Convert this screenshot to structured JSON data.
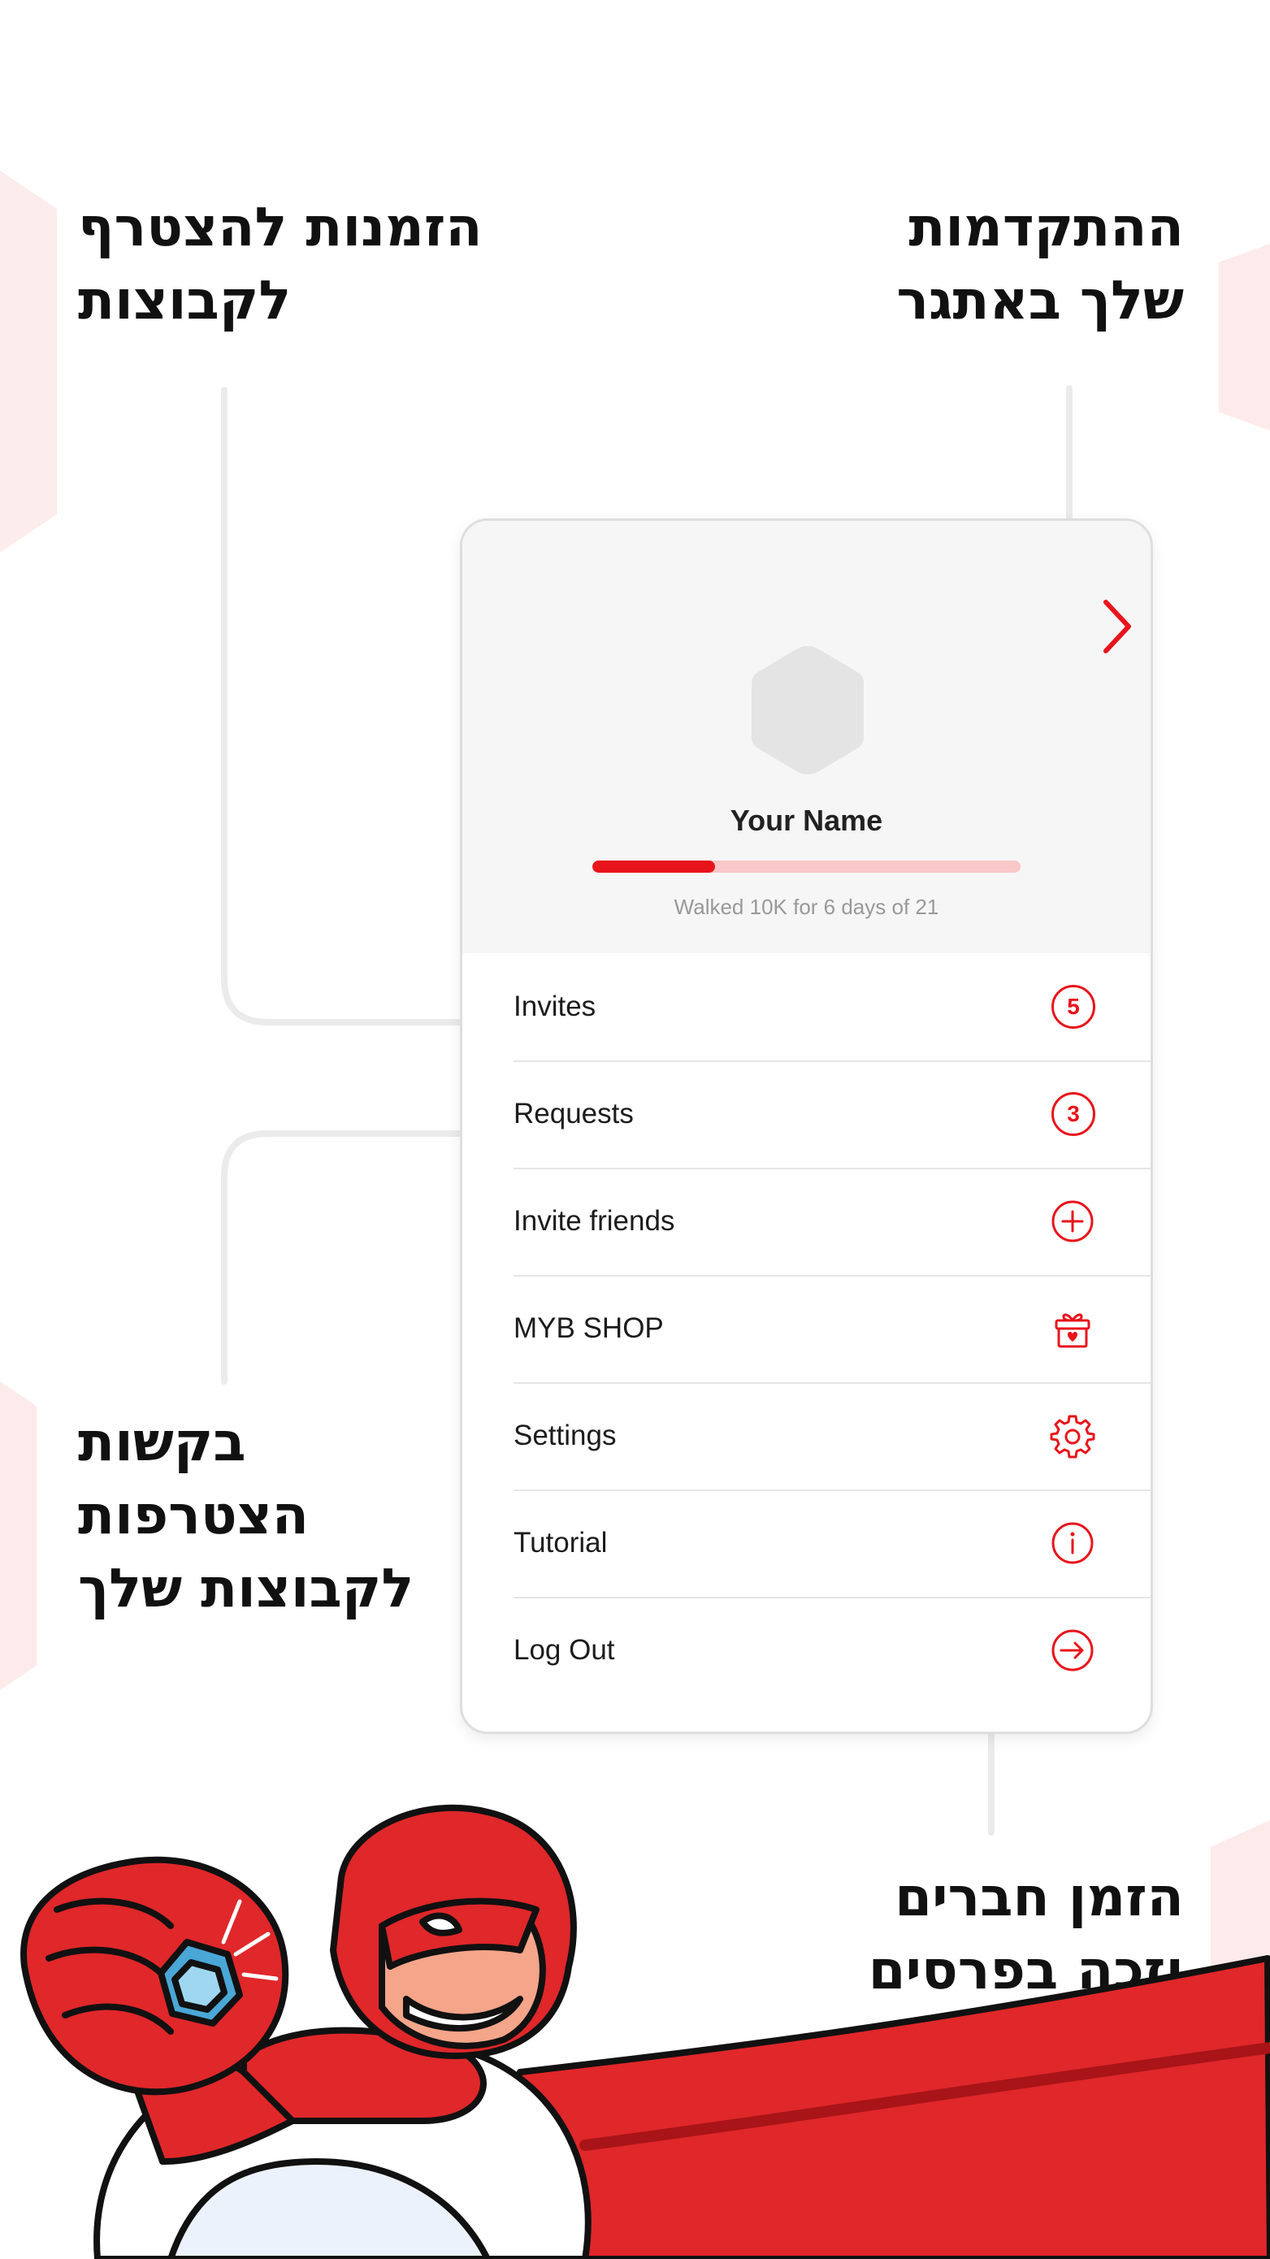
{
  "captions": {
    "progress": "ההתקדמות\nשלך באתגר",
    "invites": "הזמנות להצטרף\nלקבוצות",
    "requests": "בקשות\nהצטרפות\nלקבוצות שלך",
    "invite_friends": "הזמן חברים\nוזכה בפרסים"
  },
  "profile": {
    "name": "Your Name",
    "progress_text": "Walked 10K for 6 days of 21",
    "progress_value": 6,
    "progress_total": 21
  },
  "menu": {
    "items": [
      {
        "label": "Invites",
        "badge": "5",
        "icon": "badge"
      },
      {
        "label": "Requests",
        "badge": "3",
        "icon": "badge"
      },
      {
        "label": "Invite friends",
        "icon": "plus-circle-icon"
      },
      {
        "label": "MYB SHOP",
        "icon": "gift-icon"
      },
      {
        "label": "Settings",
        "icon": "gear-icon"
      },
      {
        "label": "Tutorial",
        "icon": "info-icon"
      },
      {
        "label": "Log Out",
        "icon": "logout-icon"
      }
    ]
  },
  "colors": {
    "accent": "#e8141b",
    "progress_track": "#f9c7c7",
    "card_header_bg": "#f6f6f6"
  }
}
